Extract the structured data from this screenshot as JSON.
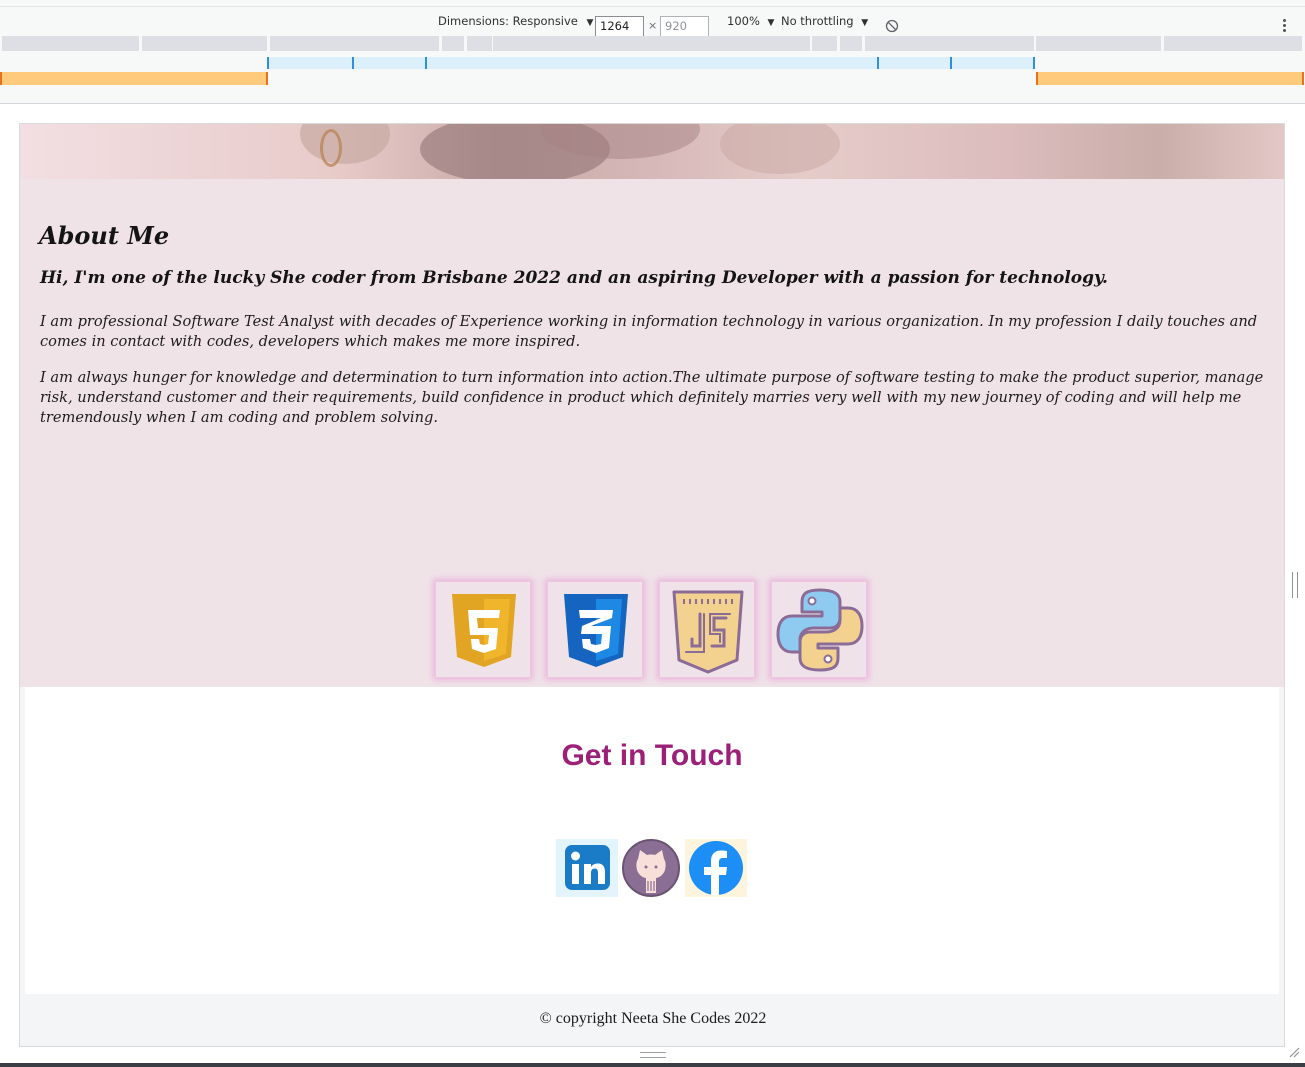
{
  "devtools": {
    "dimensions_label": "Dimensions: Responsive",
    "width_value": "1264",
    "height_placeholder": "920",
    "times": "×",
    "zoom": "100%",
    "throttling": "No throttling",
    "dropdown_arrow": "▼",
    "icons": [
      "rotate-icon",
      "more-options-icon"
    ]
  },
  "about": {
    "title": "About Me",
    "lead": "Hi, I'm one of the lucky She coder from Brisbane 2022 and an aspiring Developer with a passion for technology.",
    "paragraphs": [
      "I am professional Software Test Analyst with decades of Experience working in information technology in various organization. In my profession I daily touches and comes in contact with codes, developers which makes me more inspired.",
      "I am always hunger for knowledge and determination to turn information into action.The ultimate purpose of software testing to make the product superior, manage risk, understand customer and their requirements, build confidence in product which definitely marries very well with my new journey of coding and will help me tremendously when I am coding and problem solving."
    ],
    "skills": [
      "html5-icon",
      "css3-icon",
      "javascript-icon",
      "python-icon"
    ]
  },
  "contact": {
    "title": "Get in Touch",
    "social": [
      "linkedin-icon",
      "github-icon",
      "facebook-icon"
    ]
  },
  "footer": {
    "copyright": "© copyright Neeta She Codes 2022"
  },
  "colors": {
    "about_bg": "#f0e3e8",
    "contact_title": "#9c1f78",
    "skill_glow": "#e68cd2"
  }
}
